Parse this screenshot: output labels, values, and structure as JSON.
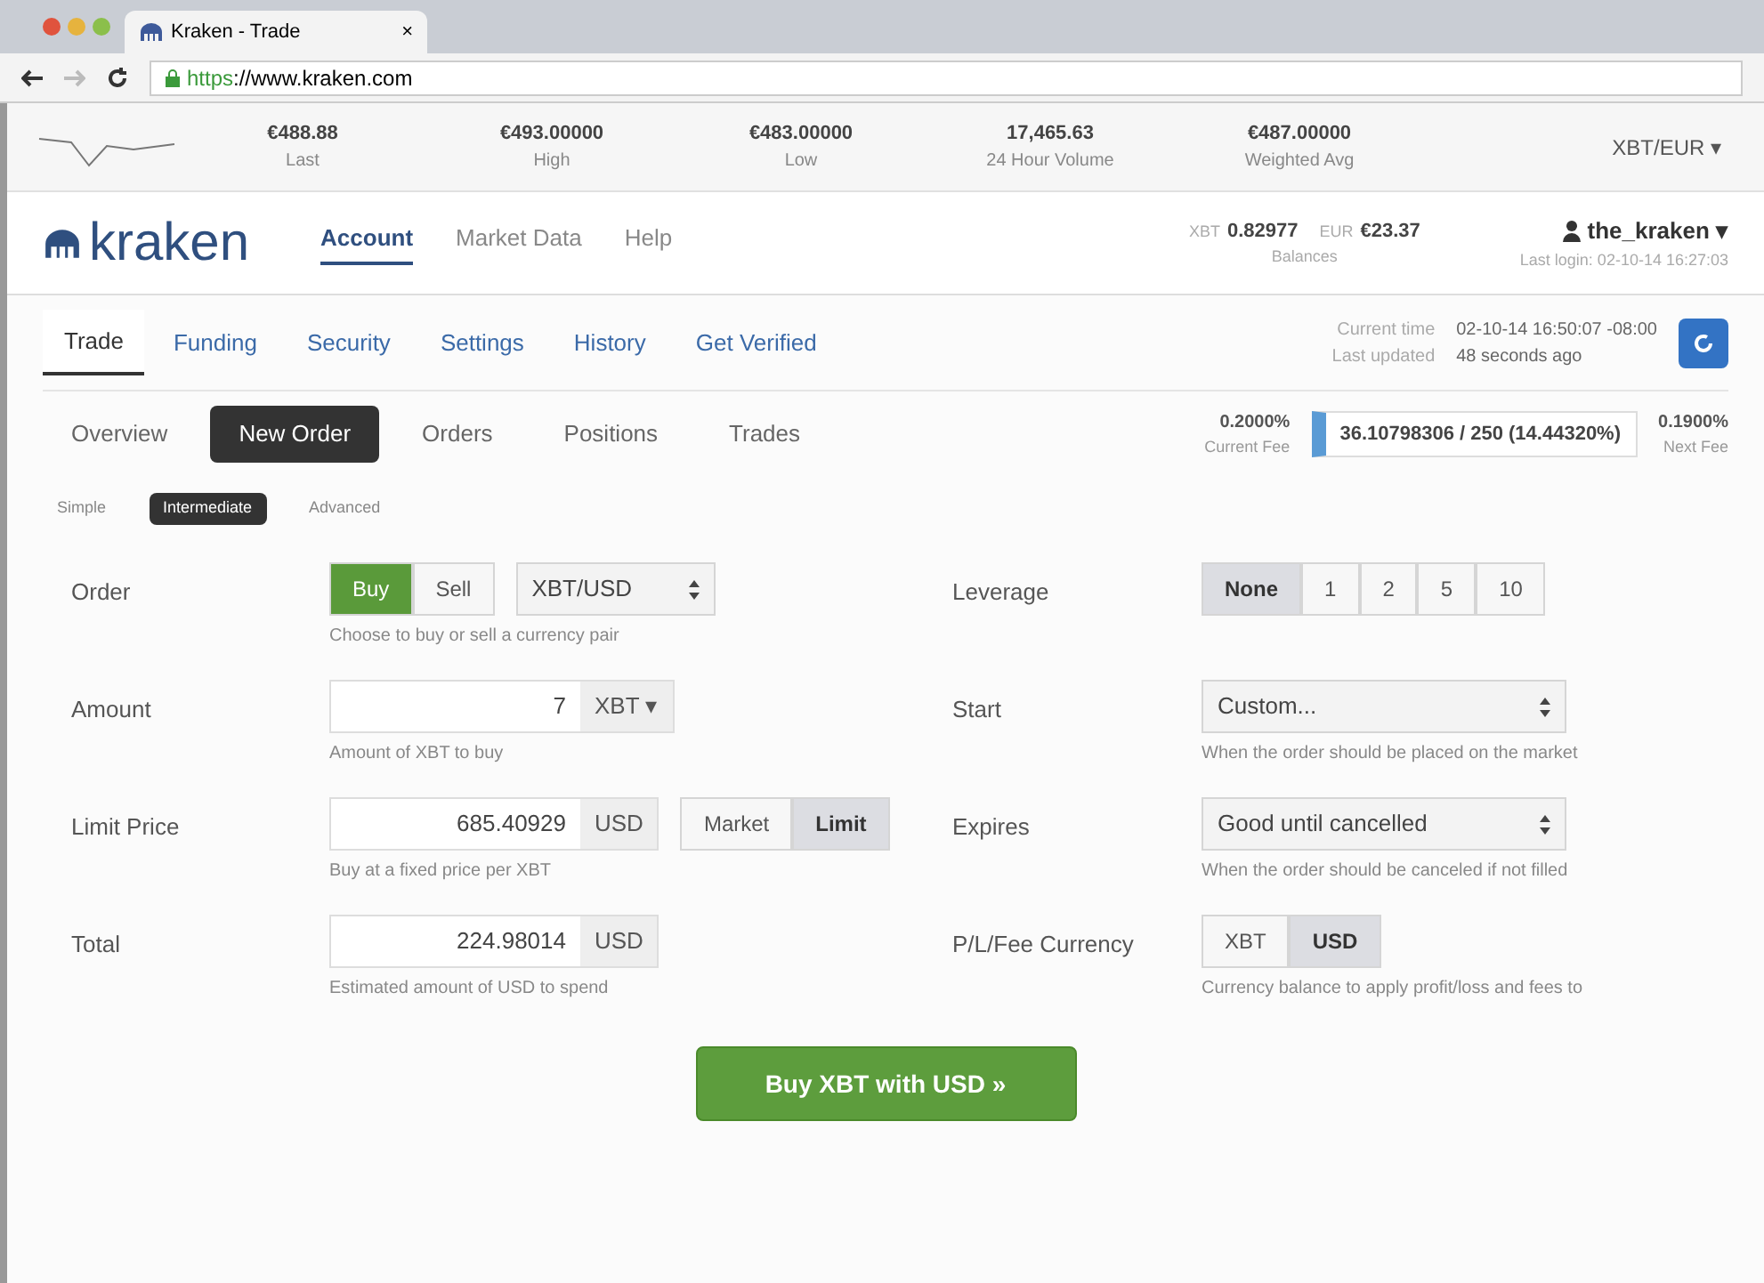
{
  "browser": {
    "tab_title": "Kraken - Trade",
    "tab_close": "×",
    "url_scheme": "https",
    "url_rest": "://www.kraken.com"
  },
  "ticker": {
    "stats": [
      {
        "value": "€488.88",
        "label": "Last"
      },
      {
        "value": "€493.00000",
        "label": "High"
      },
      {
        "value": "€483.00000",
        "label": "Low"
      },
      {
        "value": "17,465.63",
        "label": "24 Hour Volume"
      },
      {
        "value": "€487.00000",
        "label": "Weighted Avg"
      }
    ],
    "pair": "XBT/EUR ▾"
  },
  "header": {
    "logo": "kraken",
    "nav": [
      {
        "label": "Account",
        "selected": true
      },
      {
        "label": "Market Data",
        "selected": false
      },
      {
        "label": "Help",
        "selected": false
      }
    ],
    "balances": [
      {
        "code": "XBT",
        "value": "0.82977"
      },
      {
        "code": "EUR",
        "value": "€23.37"
      }
    ],
    "balances_label": "Balances",
    "user": "the_kraken ▾",
    "last_login": "Last login: 02-10-14 16:27:03"
  },
  "account_tabs": [
    {
      "label": "Trade",
      "selected": true
    },
    {
      "label": "Funding",
      "selected": false
    },
    {
      "label": "Security",
      "selected": false
    },
    {
      "label": "Settings",
      "selected": false
    },
    {
      "label": "History",
      "selected": false
    },
    {
      "label": "Get Verified",
      "selected": false
    }
  ],
  "status": {
    "time_label": "Current time",
    "time": "02-10-14 16:50:07 -08:00",
    "updated_label": "Last updated",
    "updated": "48 seconds ago"
  },
  "trade_tabs": [
    {
      "label": "Overview",
      "selected": false
    },
    {
      "label": "New Order",
      "selected": true
    },
    {
      "label": "Orders",
      "selected": false
    },
    {
      "label": "Positions",
      "selected": false
    },
    {
      "label": "Trades",
      "selected": false
    }
  ],
  "fees": {
    "current": "0.2000%",
    "current_label": "Current Fee",
    "volume": "36.10798306 / 250 (14.44320%)",
    "next": "0.1900%",
    "next_label": "Next Fee"
  },
  "order_modes": [
    {
      "label": "Simple",
      "selected": false
    },
    {
      "label": "Intermediate",
      "selected": true
    },
    {
      "label": "Advanced",
      "selected": false
    }
  ],
  "form_left": [
    {
      "kind": "side",
      "label": "Order",
      "options": [
        {
          "label": "Buy",
          "selected": true
        },
        {
          "label": "Sell",
          "selected": false
        }
      ],
      "select": "XBT/USD",
      "hint": "Choose to buy or sell a currency pair"
    },
    {
      "kind": "amount",
      "label": "Amount",
      "value": "7",
      "unit": "XBT ▾",
      "hint": "Amount of XBT to buy"
    },
    {
      "kind": "price",
      "label": "Limit Price",
      "value": "685.40929",
      "unit": "USD",
      "options": [
        {
          "label": "Market",
          "selected": false
        },
        {
          "label": "Limit",
          "selected": true
        }
      ],
      "hint": "Buy at a fixed price per XBT"
    },
    {
      "kind": "amount",
      "label": "Total",
      "value": "224.98014",
      "unit": "USD",
      "hint": "Estimated amount of USD to spend"
    }
  ],
  "form_right": [
    {
      "kind": "toggle",
      "label": "Leverage",
      "options": [
        {
          "label": "None",
          "selected": true
        },
        {
          "label": "1",
          "selected": false
        },
        {
          "label": "2",
          "selected": false
        },
        {
          "label": "5",
          "selected": false
        },
        {
          "label": "10",
          "selected": false
        }
      ]
    },
    {
      "kind": "select",
      "label": "Start",
      "value": "Custom...",
      "hint": "When the order should be placed on the market"
    },
    {
      "kind": "select",
      "label": "Expires",
      "value": "Good until cancelled",
      "hint": "When the order should be canceled if not filled"
    },
    {
      "kind": "toggle",
      "label": "P/L/Fee Currency",
      "options": [
        {
          "label": "XBT",
          "selected": false
        },
        {
          "label": "USD",
          "selected": true
        }
      ],
      "hint": "Currency balance to apply profit/loss and fees to"
    }
  ],
  "submit": "Buy XBT with USD »"
}
